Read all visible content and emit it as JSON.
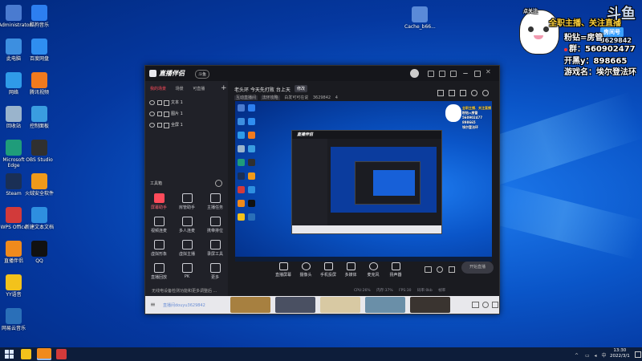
{
  "desktop": {
    "icons_left": [
      {
        "label": "Administrator",
        "color": "#4a7bd0"
      },
      {
        "label": "此电脑",
        "color": "#3d8fe0"
      },
      {
        "label": "网络",
        "color": "#2f9be8"
      },
      {
        "label": "回收站",
        "color": "#9ab4cc"
      },
      {
        "label": "Microsoft Edge",
        "color": "#1f9c7a"
      },
      {
        "label": "Steam",
        "color": "#1a2f55"
      },
      {
        "label": "WPS Office",
        "color": "#d23a3a"
      },
      {
        "label": "直播伴侣",
        "color": "#f08a1c"
      },
      {
        "label": "YY语音",
        "color": "#f3c21b"
      },
      {
        "label": "网易云音乐",
        "color": "#2a6fb8"
      }
    ],
    "icons_col2": [
      {
        "label": "酷狗音乐",
        "color": "#2d7ff0"
      },
      {
        "label": "百度网盘",
        "color": "#2f8ef0"
      },
      {
        "label": "腾讯视频",
        "color": "#f07a1e"
      },
      {
        "label": "控制面板",
        "color": "#3a9de0"
      },
      {
        "label": "OBS Studio",
        "color": "#303030"
      },
      {
        "label": "火绒安全软件",
        "color": "#f09a1a"
      },
      {
        "label": "新建文本文档",
        "color": "#2e8fe0"
      },
      {
        "label": "QQ",
        "color": "#111111"
      }
    ],
    "icon_right": {
      "label": "Cache_b66..."
    }
  },
  "overlay": {
    "top_left_tag": "点关注",
    "banner": "全职主播、关注直播",
    "douyu": "斗鱼",
    "room_tag": "房间号",
    "room_no": "3629842",
    "line1_label": "粉钻=房管",
    "line2_label": "群：",
    "line2_value": "560902477",
    "line3_label": "开黑y：",
    "line3_value": "898665",
    "line4_label": "游戏名：",
    "line4_value": "埃尔登法环"
  },
  "app": {
    "title": "直播伴侣",
    "badge": "斗鱼",
    "tabs": [
      "我的场景",
      "场景",
      "可直播"
    ],
    "sources": [
      {
        "name": "文本 1"
      },
      {
        "name": "图片 1"
      },
      {
        "name": "全屏 1"
      }
    ],
    "toolbox_label": "工具箱",
    "tools": [
      "屏幕助手",
      "房管助手",
      "主播任务",
      "视频连麦",
      "多人连麦",
      "携带排位",
      "虚拟形象",
      "虚拟主播",
      "录屏工具",
      "直播回放",
      "PK",
      "更多"
    ],
    "stream_title": "老头环 今天先打败 台上天",
    "stream_tag": "修改",
    "sub_info": [
      "互动直播间",
      "法环攻略",
      "白发可可在说",
      "3629842",
      "4"
    ],
    "controls": [
      "直播屏幕",
      "摄像头",
      "手机投屏",
      "多媒体",
      "麦克风",
      "扬声器"
    ],
    "start_button": "开始直播",
    "bottom_note": "无线电设备检测功能和更多调整后 ...",
    "room_link": "直播间douyu3629842",
    "footer_stats": [
      "CPU:26%",
      "内存:37%",
      "FPS:30",
      "码率:0kb",
      "帧率"
    ],
    "preview_text": "老头环 今天先打败 台上天"
  },
  "taskbar": {
    "time": "13:30",
    "date": "2022/3/1"
  }
}
